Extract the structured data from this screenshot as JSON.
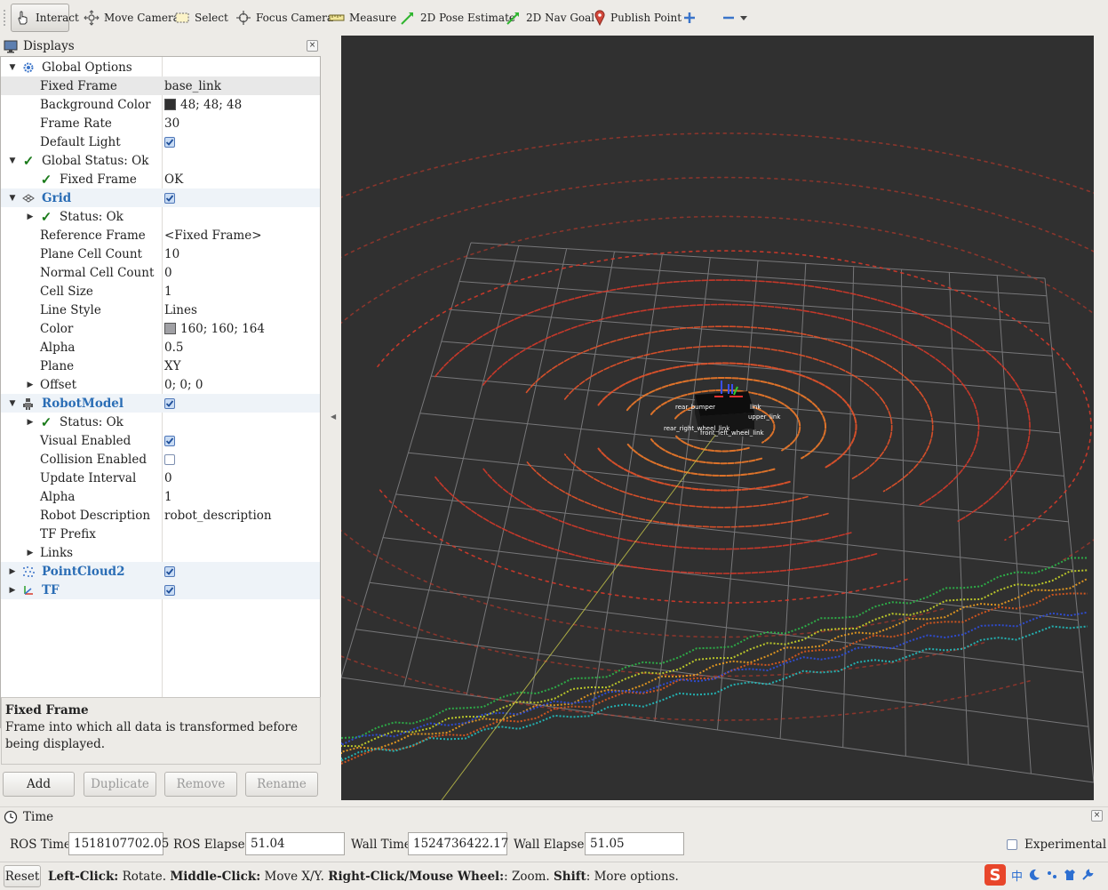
{
  "toolbar": {
    "tools": [
      {
        "label": "Interact",
        "icon": "hand-pointer-icon"
      },
      {
        "label": "Move Camera",
        "icon": "move-camera-icon"
      },
      {
        "label": "Select",
        "icon": "select-rectangle-icon"
      },
      {
        "label": "Focus Camera",
        "icon": "focus-crosshair-icon"
      },
      {
        "label": "Measure",
        "icon": "ruler-icon"
      },
      {
        "label": "2D Pose Estimate",
        "icon": "green-arrow-icon"
      },
      {
        "label": "2D Nav Goal",
        "icon": "green-arrow-icon"
      },
      {
        "label": "Publish Point",
        "icon": "map-pin-icon"
      }
    ],
    "active_tool": "Interact"
  },
  "displays": {
    "title": "Displays",
    "rows": [
      {
        "name": "Global Options",
        "value": ""
      },
      {
        "name": "Fixed Frame",
        "value": "base_link"
      },
      {
        "name": "Background Color",
        "value": "48; 48; 48",
        "color": "#303030"
      },
      {
        "name": "Frame Rate",
        "value": "30"
      },
      {
        "name": "Default Light",
        "value": ""
      },
      {
        "name": "Global Status: Ok",
        "value": ""
      },
      {
        "name": "Fixed Frame",
        "value": "OK"
      },
      {
        "name": "Grid",
        "value": ""
      },
      {
        "name": "Status: Ok",
        "value": ""
      },
      {
        "name": "Reference Frame",
        "value": "<Fixed Frame>"
      },
      {
        "name": "Plane Cell Count",
        "value": "10"
      },
      {
        "name": "Normal Cell Count",
        "value": "0"
      },
      {
        "name": "Cell Size",
        "value": "1"
      },
      {
        "name": "Line Style",
        "value": "Lines"
      },
      {
        "name": "Color",
        "value": "160; 160; 164",
        "color": "#a0a0a4"
      },
      {
        "name": "Alpha",
        "value": "0.5"
      },
      {
        "name": "Plane",
        "value": "XY"
      },
      {
        "name": "Offset",
        "value": "0; 0; 0"
      },
      {
        "name": "RobotModel",
        "value": ""
      },
      {
        "name": "Status: Ok",
        "value": ""
      },
      {
        "name": "Visual Enabled",
        "value": ""
      },
      {
        "name": "Collision Enabled",
        "value": ""
      },
      {
        "name": "Update Interval",
        "value": "0"
      },
      {
        "name": "Alpha",
        "value": "1"
      },
      {
        "name": "Robot Description",
        "value": "robot_description"
      },
      {
        "name": "TF Prefix",
        "value": ""
      },
      {
        "name": "Links",
        "value": ""
      },
      {
        "name": "PointCloud2",
        "value": ""
      },
      {
        "name": "TF",
        "value": ""
      }
    ],
    "description": {
      "title": "Fixed Frame",
      "text": "Frame into which all data is transformed before being displayed."
    },
    "buttons": {
      "add": "Add",
      "duplicate": "Duplicate",
      "remove": "Remove",
      "rename": "Rename"
    }
  },
  "robot_labels": [
    "rear_bumper",
    "link",
    "upper_link",
    "rear_right_wheel_link",
    "front_left_wheel_link"
  ],
  "time": {
    "title": "Time",
    "ros_time_label": "ROS Time:",
    "ros_time": "1518107702.05",
    "ros_elapsed_label": "ROS Elapsed:",
    "ros_elapsed": "51.04",
    "wall_time_label": "Wall Time:",
    "wall_time": "1524736422.17",
    "wall_elapsed_label": "Wall Elapsed:",
    "wall_elapsed": "51.05",
    "experimental_label": "Experimental"
  },
  "status": {
    "reset_label": "Reset",
    "hint_b1": "Left-Click:",
    "hint_t1": " Rotate. ",
    "hint_b2": "Middle-Click:",
    "hint_t2": " Move X/Y. ",
    "hint_b3": "Right-Click/Mouse Wheel:",
    "hint_t3": ": Zoom. ",
    "hint_b4": "Shift",
    "hint_t4": ": More options.",
    "ime_text": "中"
  },
  "colors": {
    "plugin_blue": "#2a6db5",
    "viewport_bg": "#303030",
    "ok_green": "#1a7a1a"
  }
}
